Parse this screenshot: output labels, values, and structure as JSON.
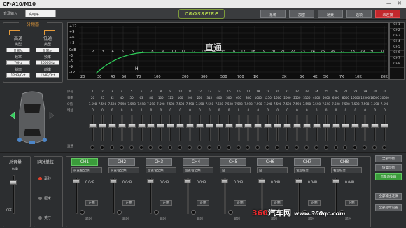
{
  "window": {
    "title": "CF-A10/M10",
    "min": "—",
    "close": "✕"
  },
  "toolbar": {
    "input_label": "音源输入",
    "input_value": "高电平",
    "logo": "CROSSFIRE",
    "buttons": [
      "系统",
      "加密",
      "场景",
      "选项",
      "未连接"
    ]
  },
  "crossover": {
    "title": "分频器",
    "hp_label": "高通",
    "lp_label": "低通",
    "type_label": "类型",
    "freq_label": "频率",
    "slope_label": "斜率",
    "hp_type": "贝塞尔",
    "lp_type": "贝塞尔",
    "hp_freq": "70Hz",
    "lp_freq": "20000Hz",
    "hp_slope": "12dB/Oct",
    "lp_slope": "12dB/Oct"
  },
  "graph": {
    "y_labels": [
      "+12",
      "+9",
      "+6",
      "+3",
      "0dB",
      "-3",
      "-6",
      "-9",
      "-12"
    ],
    "x_labels": [
      "20",
      "30",
      "40",
      "50",
      "70",
      "100",
      "200",
      "300",
      "500",
      "700",
      "1K",
      "2K",
      "3K",
      "4K",
      "5K",
      "7K",
      "10K",
      "20K"
    ],
    "band_numbers": [
      "1",
      "2",
      "3",
      "4",
      "5",
      "6",
      "7",
      "8",
      "9",
      "10",
      "11",
      "12",
      "13",
      "14",
      "15",
      "16",
      "17",
      "18",
      "19",
      "20",
      "21",
      "22",
      "23",
      "24",
      "25",
      "26",
      "27",
      "28",
      "29",
      "30",
      "31"
    ],
    "overlay_text": "直通",
    "marker": "H"
  },
  "channel_list": [
    "CH1",
    "CH2",
    "CH3",
    "CH4",
    "CH5",
    "CH6",
    "CH7",
    "CH8"
  ],
  "eq": {
    "row_labels": [
      "序号",
      "频率",
      "Q值",
      "增益"
    ],
    "bypass_label": "直通",
    "bands": [
      {
        "n": "1",
        "f": "20",
        "q": "7.598",
        "g": "0"
      },
      {
        "n": "2",
        "f": "25",
        "q": "7.598",
        "g": "0"
      },
      {
        "n": "3",
        "f": "32",
        "q": "7.598",
        "g": "0"
      },
      {
        "n": "4",
        "f": "40",
        "q": "7.598",
        "g": "0"
      },
      {
        "n": "5",
        "f": "50",
        "q": "7.598",
        "g": "0"
      },
      {
        "n": "6",
        "f": "63",
        "q": "7.598",
        "g": "0"
      },
      {
        "n": "7",
        "f": "80",
        "q": "7.598",
        "g": "0"
      },
      {
        "n": "8",
        "f": "100",
        "q": "7.598",
        "g": "0"
      },
      {
        "n": "9",
        "f": "125",
        "q": "7.598",
        "g": "0"
      },
      {
        "n": "10",
        "f": "160",
        "q": "7.598",
        "g": "0"
      },
      {
        "n": "11",
        "f": "200",
        "q": "7.598",
        "g": "0"
      },
      {
        "n": "12",
        "f": "250",
        "q": "7.598",
        "g": "0"
      },
      {
        "n": "13",
        "f": "315",
        "q": "7.598",
        "g": "0"
      },
      {
        "n": "14",
        "f": "400",
        "q": "7.598",
        "g": "0"
      },
      {
        "n": "15",
        "f": "500",
        "q": "7.598",
        "g": "0"
      },
      {
        "n": "16",
        "f": "630",
        "q": "7.598",
        "g": "0"
      },
      {
        "n": "17",
        "f": "800",
        "q": "7.598",
        "g": "0"
      },
      {
        "n": "18",
        "f": "1000",
        "q": "7.598",
        "g": "0"
      },
      {
        "n": "19",
        "f": "1250",
        "q": "7.598",
        "g": "0"
      },
      {
        "n": "20",
        "f": "1600",
        "q": "7.598",
        "g": "0"
      },
      {
        "n": "21",
        "f": "2000",
        "q": "7.598",
        "g": "0"
      },
      {
        "n": "22",
        "f": "2500",
        "q": "7.598",
        "g": "0"
      },
      {
        "n": "23",
        "f": "3150",
        "q": "7.598",
        "g": "0"
      },
      {
        "n": "24",
        "f": "4000",
        "q": "7.598",
        "g": "0"
      },
      {
        "n": "25",
        "f": "5000",
        "q": "7.598",
        "g": "0"
      },
      {
        "n": "26",
        "f": "6300",
        "q": "7.598",
        "g": "0"
      },
      {
        "n": "27",
        "f": "8000",
        "q": "7.598",
        "g": "0"
      },
      {
        "n": "28",
        "f": "10000",
        "q": "7.598",
        "g": "0"
      },
      {
        "n": "29",
        "f": "12500",
        "q": "7.598",
        "g": "0"
      },
      {
        "n": "30",
        "f": "16000",
        "q": "7.598",
        "g": "0"
      },
      {
        "n": "31",
        "f": "20000",
        "q": "7.598",
        "g": "0"
      }
    ]
  },
  "master": {
    "title": "总音量",
    "value": "0dB",
    "off": "OFF"
  },
  "delay_unit": {
    "title": "延时单位",
    "options": [
      {
        "label": "毫秒",
        "selected": true
      },
      {
        "label": "厘米",
        "selected": false
      },
      {
        "label": "英寸",
        "selected": false
      }
    ]
  },
  "channels": [
    {
      "name": "CH1",
      "assign": "前置左全频",
      "db": "0.0dB",
      "phase": "正相",
      "delay": "延时",
      "active": true
    },
    {
      "name": "CH2",
      "assign": "前置右全频",
      "db": "0.0dB",
      "phase": "正相",
      "delay": "延时",
      "active": false
    },
    {
      "name": "CH3",
      "assign": "后置左全频",
      "db": "0.0dB",
      "phase": "正相",
      "delay": "延时",
      "active": false
    },
    {
      "name": "CH4",
      "assign": "后置右全频",
      "db": "0.0dB",
      "phase": "正相",
      "delay": "延时",
      "active": false
    },
    {
      "name": "CH5",
      "assign": "空",
      "db": "0.0dB",
      "phase": "正相",
      "delay": "延时",
      "active": false
    },
    {
      "name": "CH6",
      "assign": "空",
      "db": "0.0dB",
      "phase": "正相",
      "delay": "延时",
      "active": false
    },
    {
      "name": "CH7",
      "assign": "左超低音",
      "db": "0.0dB",
      "phase": "正相",
      "delay": "延时",
      "active": false
    },
    {
      "name": "CH8",
      "assign": "右超低音",
      "db": "0.0dB",
      "phase": "正相",
      "delay": "延时",
      "active": false
    }
  ],
  "side_buttons": [
    "全部均衡",
    "恢复均衡",
    "音量均衡器"
  ],
  "side_bottom_buttons": [
    "全部输出选项",
    "全部延时设置"
  ],
  "watermark": {
    "brand": "360",
    "text": "汽车网",
    "url": "www.360qc.com"
  },
  "colors": {
    "accent_orange": "#e49a3a",
    "active_green": "#3b9c3b",
    "alert_red": "#c3282c",
    "curve_green": "#2fd05a"
  }
}
